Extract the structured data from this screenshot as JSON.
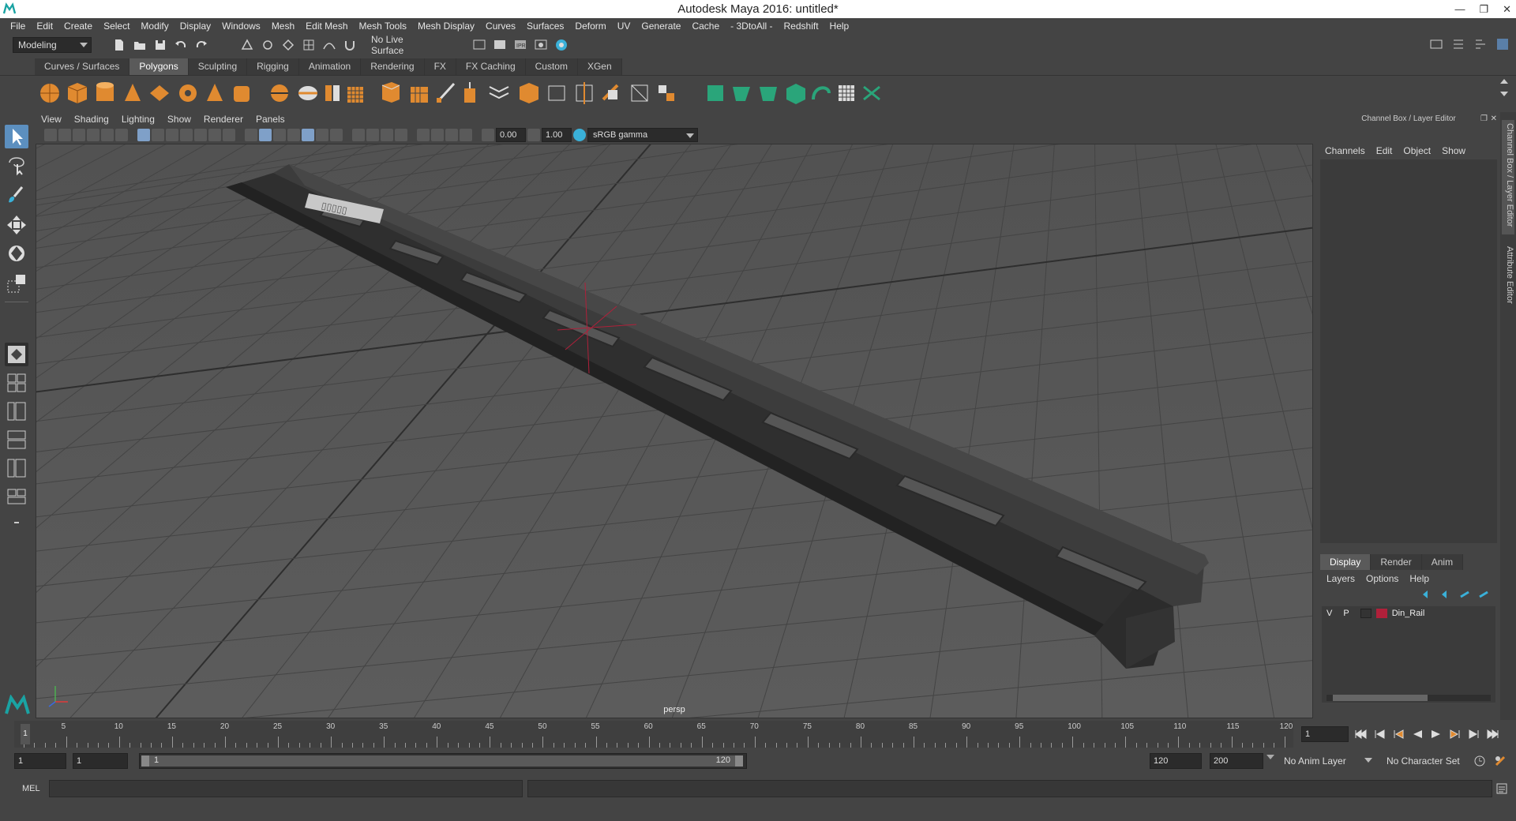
{
  "title": "Autodesk Maya 2016: untitled*",
  "menubar": [
    "File",
    "Edit",
    "Create",
    "Select",
    "Modify",
    "Display",
    "Windows",
    "Mesh",
    "Edit Mesh",
    "Mesh Tools",
    "Mesh Display",
    "Curves",
    "Surfaces",
    "Deform",
    "UV",
    "Generate",
    "Cache",
    "- 3DtoAll -",
    "Redshift",
    "Help"
  ],
  "status": {
    "mode": "Modeling",
    "live_surface": "No Live Surface"
  },
  "shelf_tabs": [
    {
      "label": "Curves / Surfaces",
      "active": false
    },
    {
      "label": "Polygons",
      "active": true
    },
    {
      "label": "Sculpting",
      "active": false
    },
    {
      "label": "Rigging",
      "active": false
    },
    {
      "label": "Animation",
      "active": false
    },
    {
      "label": "Rendering",
      "active": false
    },
    {
      "label": "FX",
      "active": false
    },
    {
      "label": "FX Caching",
      "active": false
    },
    {
      "label": "Custom",
      "active": false
    },
    {
      "label": "XGen",
      "active": false
    }
  ],
  "viewport_menu": [
    "View",
    "Shading",
    "Lighting",
    "Show",
    "Renderer",
    "Panels"
  ],
  "panel": {
    "near": "0.00",
    "far": "1.00",
    "colorspace": "sRGB gamma"
  },
  "viewport": {
    "camera_label": "persp"
  },
  "right_panel": {
    "title": "Channel Box / Layer Editor",
    "menu": [
      "Channels",
      "Edit",
      "Object",
      "Show"
    ],
    "layer_tabs": [
      {
        "label": "Display",
        "active": true
      },
      {
        "label": "Render",
        "active": false
      },
      {
        "label": "Anim",
        "active": false
      }
    ],
    "layer_menu": [
      "Layers",
      "Options",
      "Help"
    ],
    "layer": {
      "v": "V",
      "p": "P",
      "name": "Din_Rail",
      "color": "#b0203a"
    }
  },
  "side_tabs": [
    "Channel Box / Layer Editor",
    "Attribute Editor"
  ],
  "timeline": {
    "ticks": [
      "5",
      "10",
      "15",
      "20",
      "25",
      "30",
      "35",
      "40",
      "45",
      "50",
      "55",
      "60",
      "65",
      "70",
      "75",
      "80",
      "85",
      "90",
      "95",
      "100",
      "105",
      "110",
      "115",
      "120"
    ],
    "start_marker": "1",
    "current_frame": "1"
  },
  "range": {
    "start": "1",
    "start2": "1",
    "slider_start": "1",
    "slider_end": "120",
    "end": "120",
    "end2": "200",
    "anim_layer": "No Anim Layer",
    "char_set": "No Character Set"
  },
  "cmd": {
    "label": "MEL"
  }
}
